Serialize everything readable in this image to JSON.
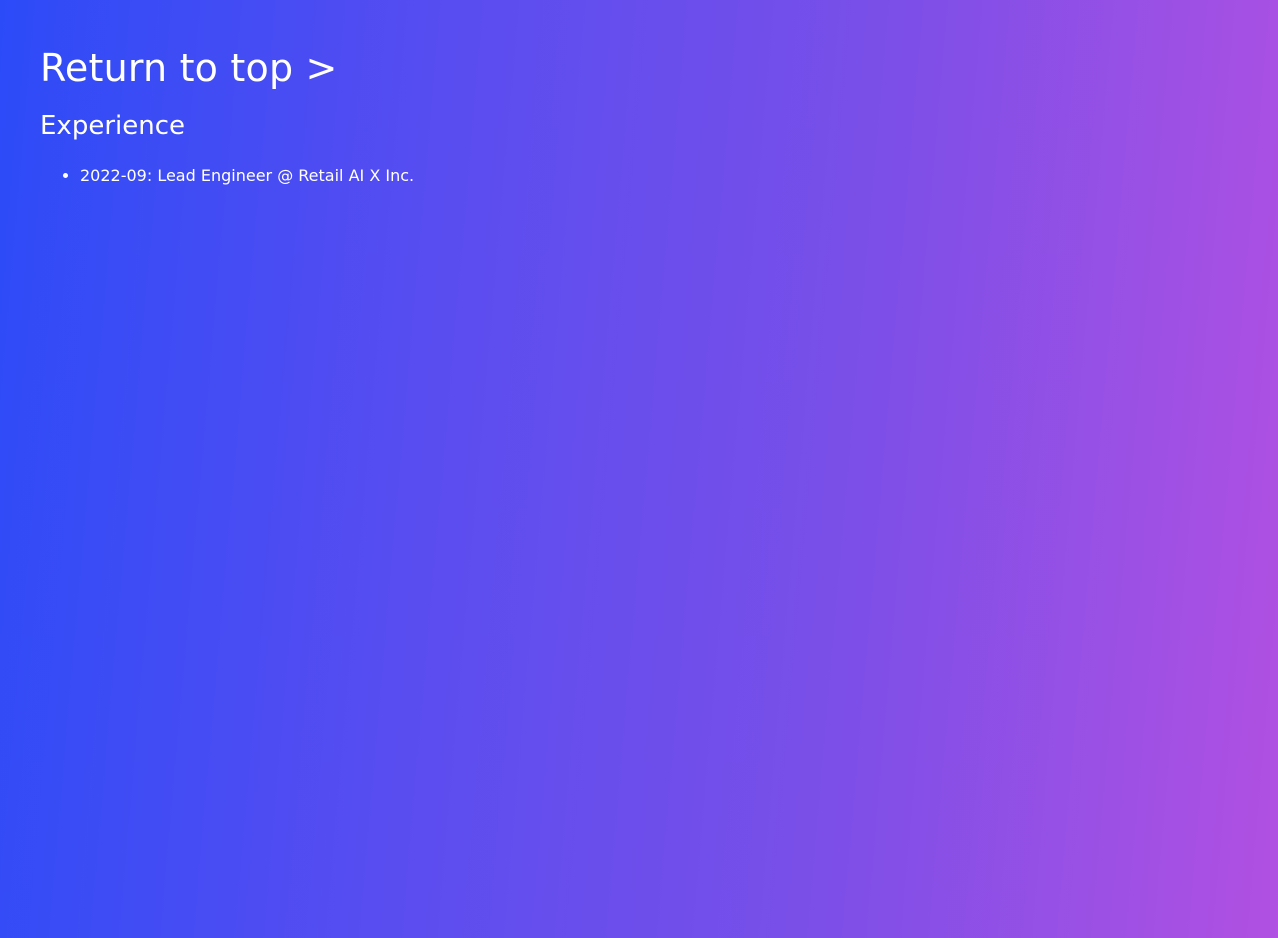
{
  "page": {
    "return_link": "Return to top >",
    "sections": {
      "experience": {
        "title": "Experience",
        "items": [
          "2022-09: Lead Engineer @ Retail AI X Inc."
        ]
      }
    }
  },
  "colors": {
    "gradient_start": "#2c4bf8",
    "gradient_end": "#b150e2",
    "text": "#ffffff"
  }
}
